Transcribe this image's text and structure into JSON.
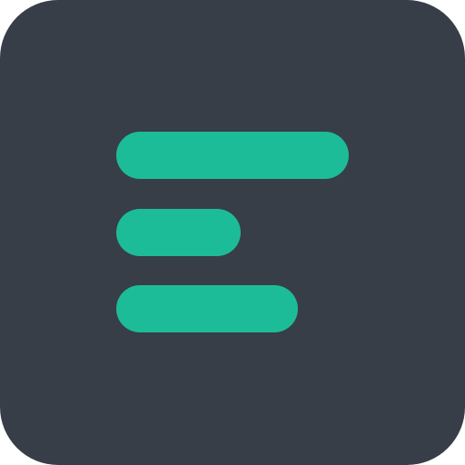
{
  "icon": {
    "name": "text-align-left-icon",
    "background_color": "#373e48",
    "accent_color": "#1dbc98",
    "bars": [
      {
        "name": "bar-long",
        "relative_length": 1.0
      },
      {
        "name": "bar-short",
        "relative_length": 0.535
      },
      {
        "name": "bar-medium",
        "relative_length": 0.78
      }
    ]
  }
}
